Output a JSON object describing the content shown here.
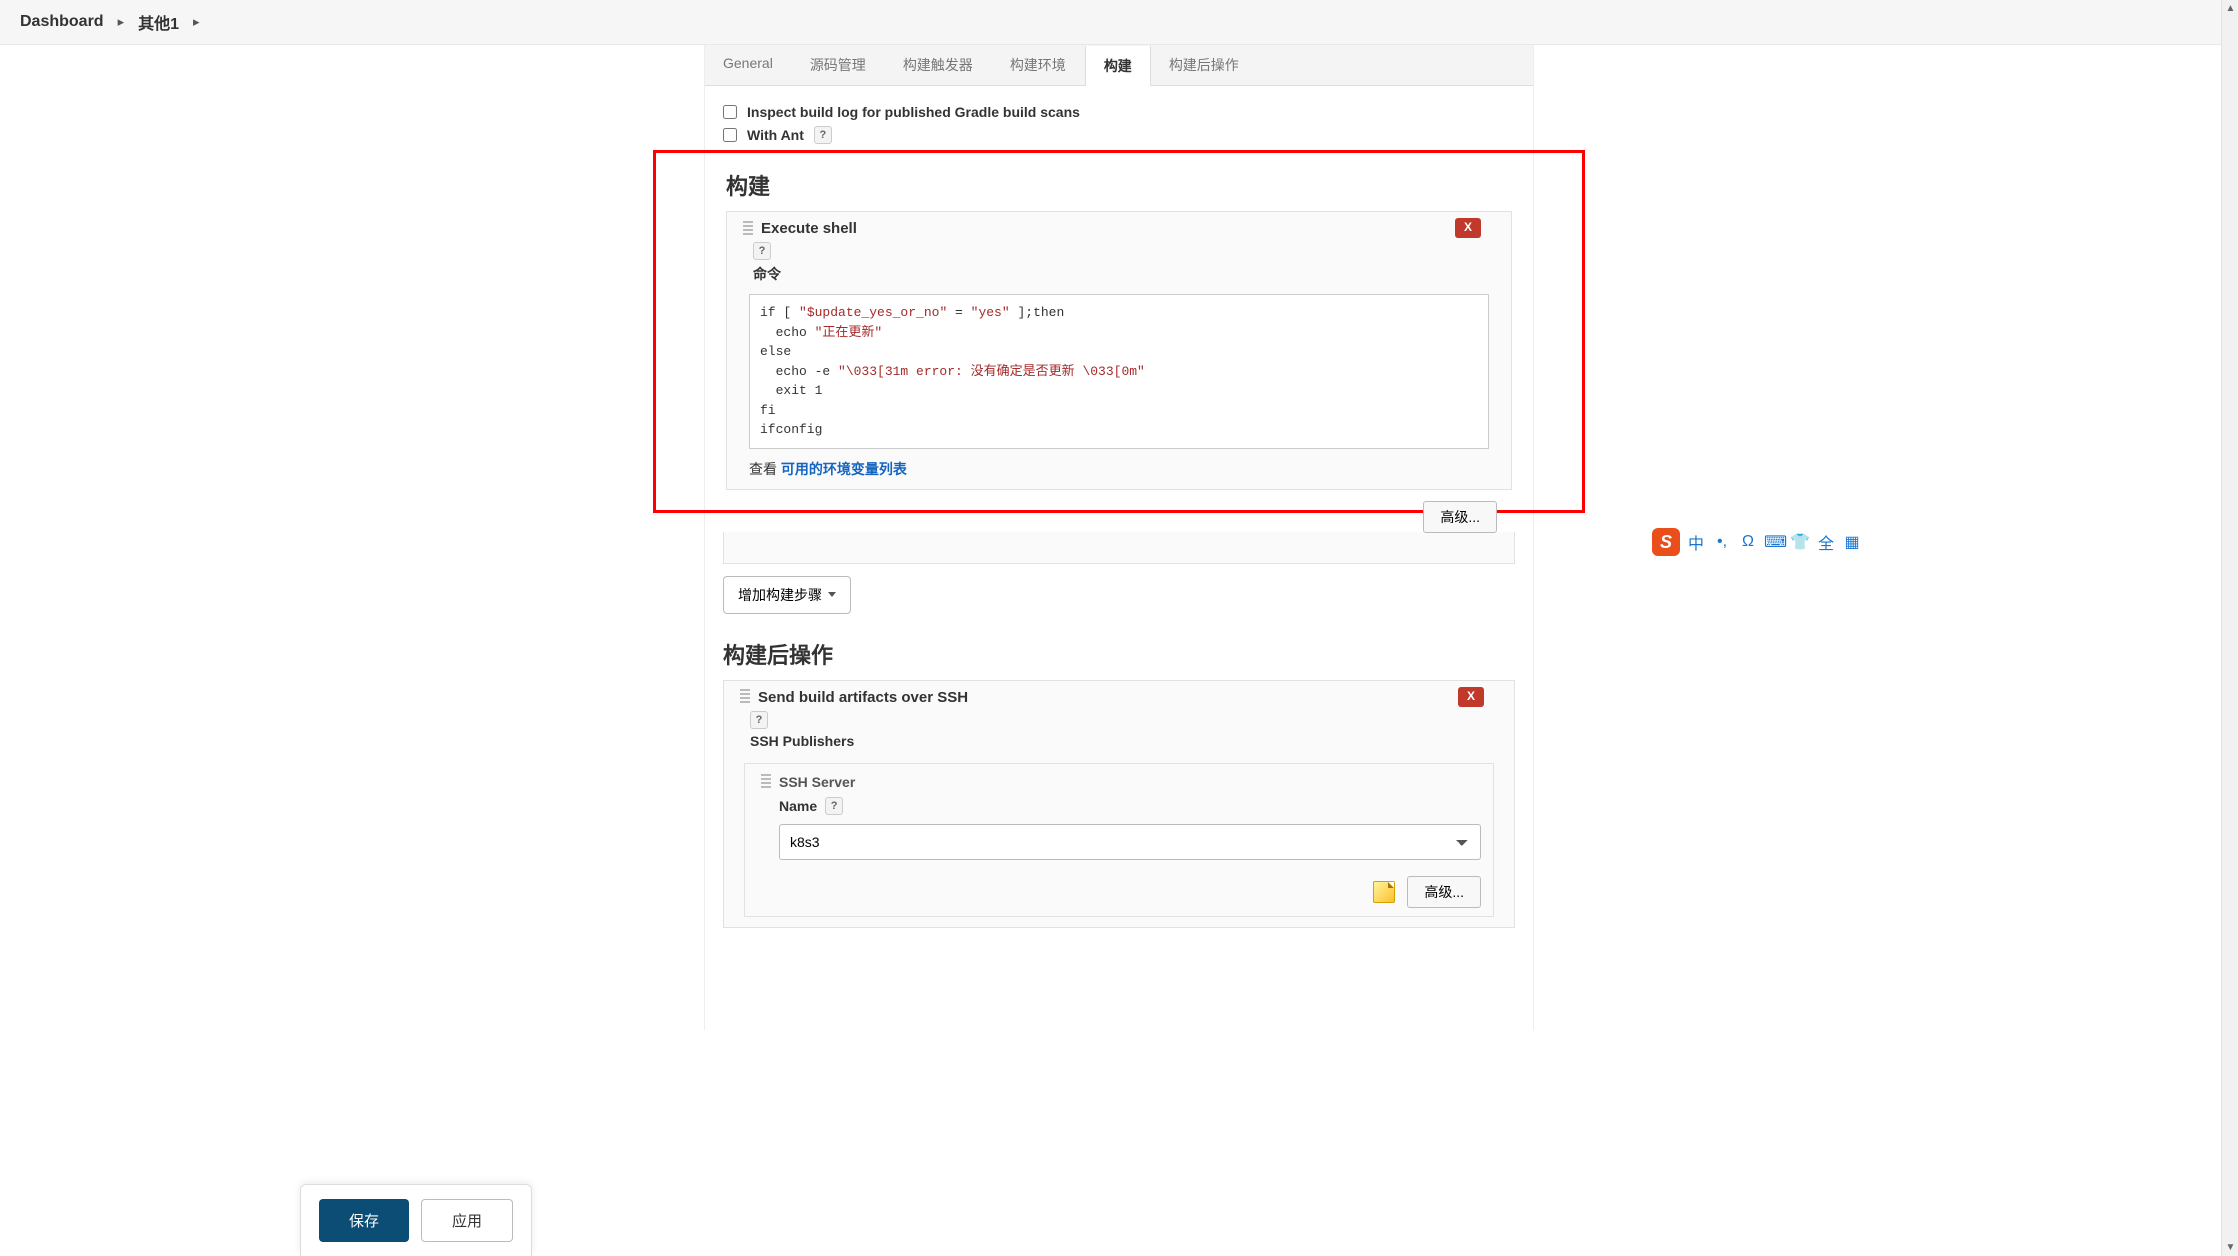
{
  "breadcrumb": {
    "root": "Dashboard",
    "item1": "其他1"
  },
  "tabs": {
    "general": "General",
    "scm": "源码管理",
    "triggers": "构建触发器",
    "env": "构建环境",
    "build": "构建",
    "post": "构建后操作"
  },
  "checks": {
    "inspect": "Inspect build log for published Gradle build scans",
    "withant": "With Ant"
  },
  "build": {
    "title": "构建",
    "step_title": "Execute shell",
    "cmd_label": "命令",
    "delete": "X",
    "see_prefix": "查看 ",
    "envlist_link": "可用的环境变量列表",
    "advanced": "高级...",
    "add_step": "增加构建步骤",
    "code_html": "<span class=\"kw\">if</span> [ <span class=\"str\">\"$update_yes_or_no\"</span> = <span class=\"str\">\"yes\"</span> ];<span class=\"kw\">then</span>\n  echo <span class=\"str\">\"正在更新\"</span>\n<span class=\"kw\">else</span>\n  echo -e <span class=\"str\">\"\\033[31m error: 没有确定是否更新 \\033[0m\"</span>\n  exit 1\n<span class=\"kw\">fi</span>\nifconfig"
  },
  "post": {
    "title": "构建后操作",
    "step_title": "Send build artifacts over SSH",
    "publishers": "SSH Publishers",
    "server": "SSH Server",
    "name_label": "Name",
    "server_value": "k8s3",
    "advanced": "高级...",
    "delete": "X"
  },
  "footer": {
    "save": "保存",
    "apply": "应用"
  },
  "ime": {
    "logo": "S",
    "zh": "中",
    "punct": "•,",
    "omega": "Ω",
    "kbd": "⌨",
    "shirt": "👕",
    "quan": "全",
    "grid": "▦"
  },
  "help": "?"
}
